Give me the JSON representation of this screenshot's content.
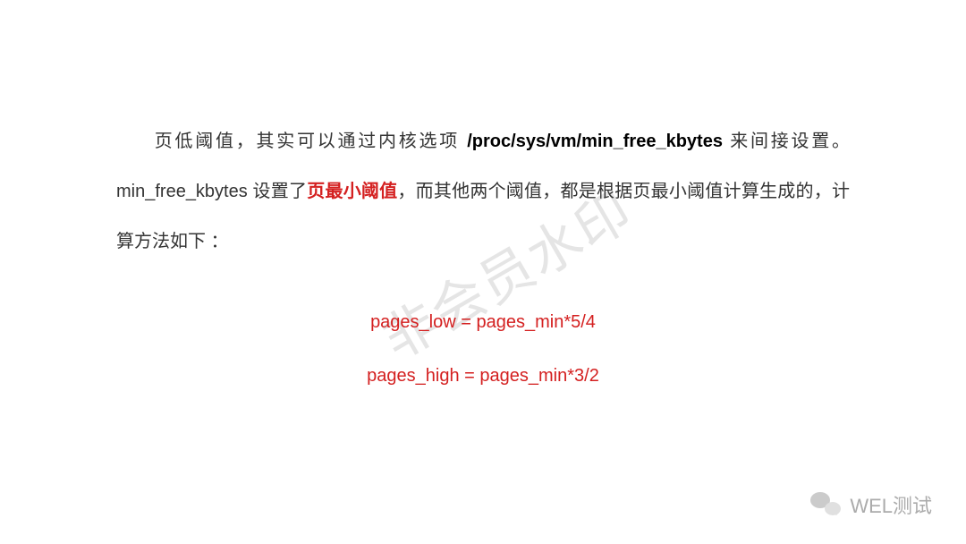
{
  "paragraph": {
    "part1_prefix_indent": "",
    "part1_a": "页低阈值，其实可以通过内核选项 ",
    "kernel_path": "/proc/sys/vm/min_free_kbytes",
    "part1_b": " 来间接设置。min_free_kbytes 设置了",
    "red_keyword": "页最小阈值",
    "part1_c": "，而其他两个阈值，都是根据页最小阈值计算生成的，计算方法如下 ："
  },
  "formulas": {
    "line1": "pages_low = pages_min*5/4",
    "line2": "pages_high = pages_min*3/2"
  },
  "watermark": "非会员水印",
  "footer": {
    "brand": "WEL测试"
  }
}
